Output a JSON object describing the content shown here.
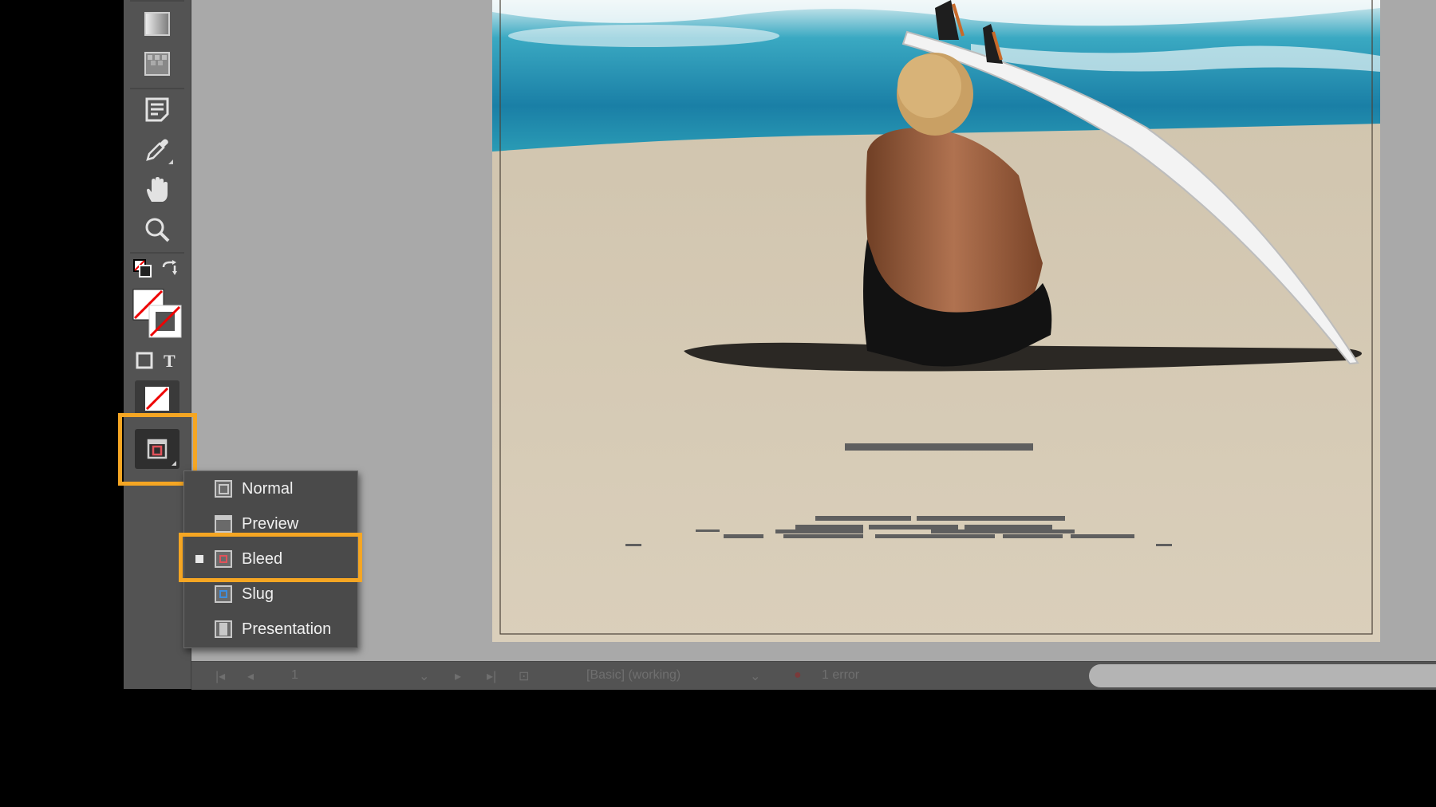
{
  "toolbar": {
    "tools": [
      {
        "name": "gradient-swatch-tool"
      },
      {
        "name": "gradient-feather-tool"
      },
      {
        "name": "note-tool"
      },
      {
        "name": "eyedropper-tool"
      },
      {
        "name": "hand-tool"
      },
      {
        "name": "zoom-tool"
      },
      {
        "name": "default-fill-stroke"
      },
      {
        "name": "swap-fill-stroke"
      },
      {
        "name": "fill-stroke-swatches"
      },
      {
        "name": "formatting-container"
      },
      {
        "name": "formatting-text"
      },
      {
        "name": "apply-none"
      },
      {
        "name": "screen-mode-button"
      }
    ]
  },
  "screen_mode_menu": {
    "items": [
      {
        "label": "Normal",
        "icon": "normal-mode-icon",
        "selected": false
      },
      {
        "label": "Preview",
        "icon": "preview-mode-icon",
        "selected": false
      },
      {
        "label": "Bleed",
        "icon": "bleed-mode-icon",
        "selected": true
      },
      {
        "label": "Slug",
        "icon": "slug-mode-icon",
        "selected": false
      },
      {
        "label": "Presentation",
        "icon": "presentation-mode-icon",
        "selected": false
      }
    ]
  },
  "statusbar": {
    "page_number": "1",
    "preflight_profile": "[Basic] (working)",
    "error_count": "1 error"
  },
  "colors": {
    "highlight": "#f5a623",
    "panel": "#535353",
    "pasteboard": "#a9a9a9",
    "sand": "#d6cbb6",
    "sea": "#2a9bb5"
  }
}
